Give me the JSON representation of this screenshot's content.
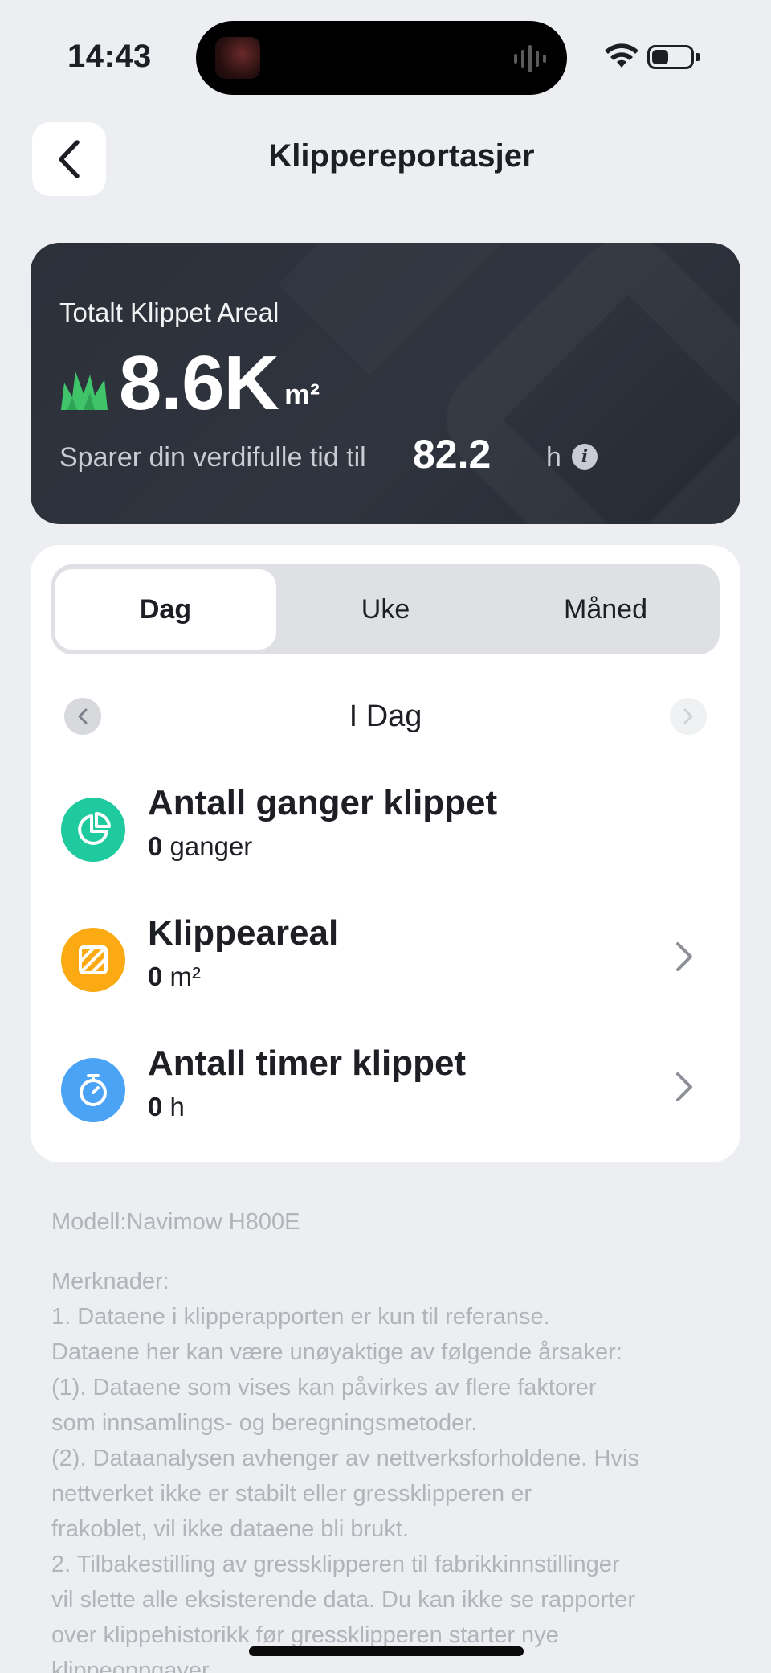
{
  "status_bar": {
    "time": "14:43"
  },
  "header": {
    "title": "Klippereportasjer"
  },
  "summary": {
    "label": "Totalt Klippet Areal",
    "value": "8.6K",
    "unit": "m²",
    "saving_text": "Sparer din verdifulle tid til",
    "saving_value": "82.2",
    "saving_unit": "h",
    "info_glyph": "i"
  },
  "tabs": [
    {
      "label": "Dag",
      "selected": true
    },
    {
      "label": "Uke",
      "selected": false
    },
    {
      "label": "Måned",
      "selected": false
    }
  ],
  "period": {
    "label": "I Dag"
  },
  "stats": [
    {
      "title": "Antall ganger klippet",
      "value": "0",
      "unit": "ganger",
      "icon": "pie-chart-icon",
      "color": "#1fcb9e"
    },
    {
      "title": "Klippeareal",
      "value": "0",
      "unit": "m²",
      "icon": "area-icon",
      "color": "#fbaa14"
    },
    {
      "title": "Antall timer klippet",
      "value": "0",
      "unit": "h",
      "icon": "timer-icon",
      "color": "#4aa3f5"
    }
  ],
  "footer": {
    "model": "Modell:Navimow H800E",
    "notes": [
      "Merknader:",
      "1. Dataene i klipperapporten er kun til referanse.",
      "Dataene her kan være unøyaktige av følgende årsaker:",
      "(1). Dataene som vises kan påvirkes av flere faktorer",
      "som innsamlings- og beregningsmetoder.",
      "(2). Dataanalysen avhenger av nettverksforholdene. Hvis",
      "nettverket ikke er stabilt eller gressklipperen er",
      "frakoblet, vil ikke dataene bli brukt.",
      "2. Tilbakestilling av gressklipperen til fabrikkinnstillinger",
      "vil slette alle eksisterende data. Du kan ikke se rapporter",
      "over klippehistorikk før gressklipperen starter nye",
      "klippeoppgaver."
    ]
  }
}
